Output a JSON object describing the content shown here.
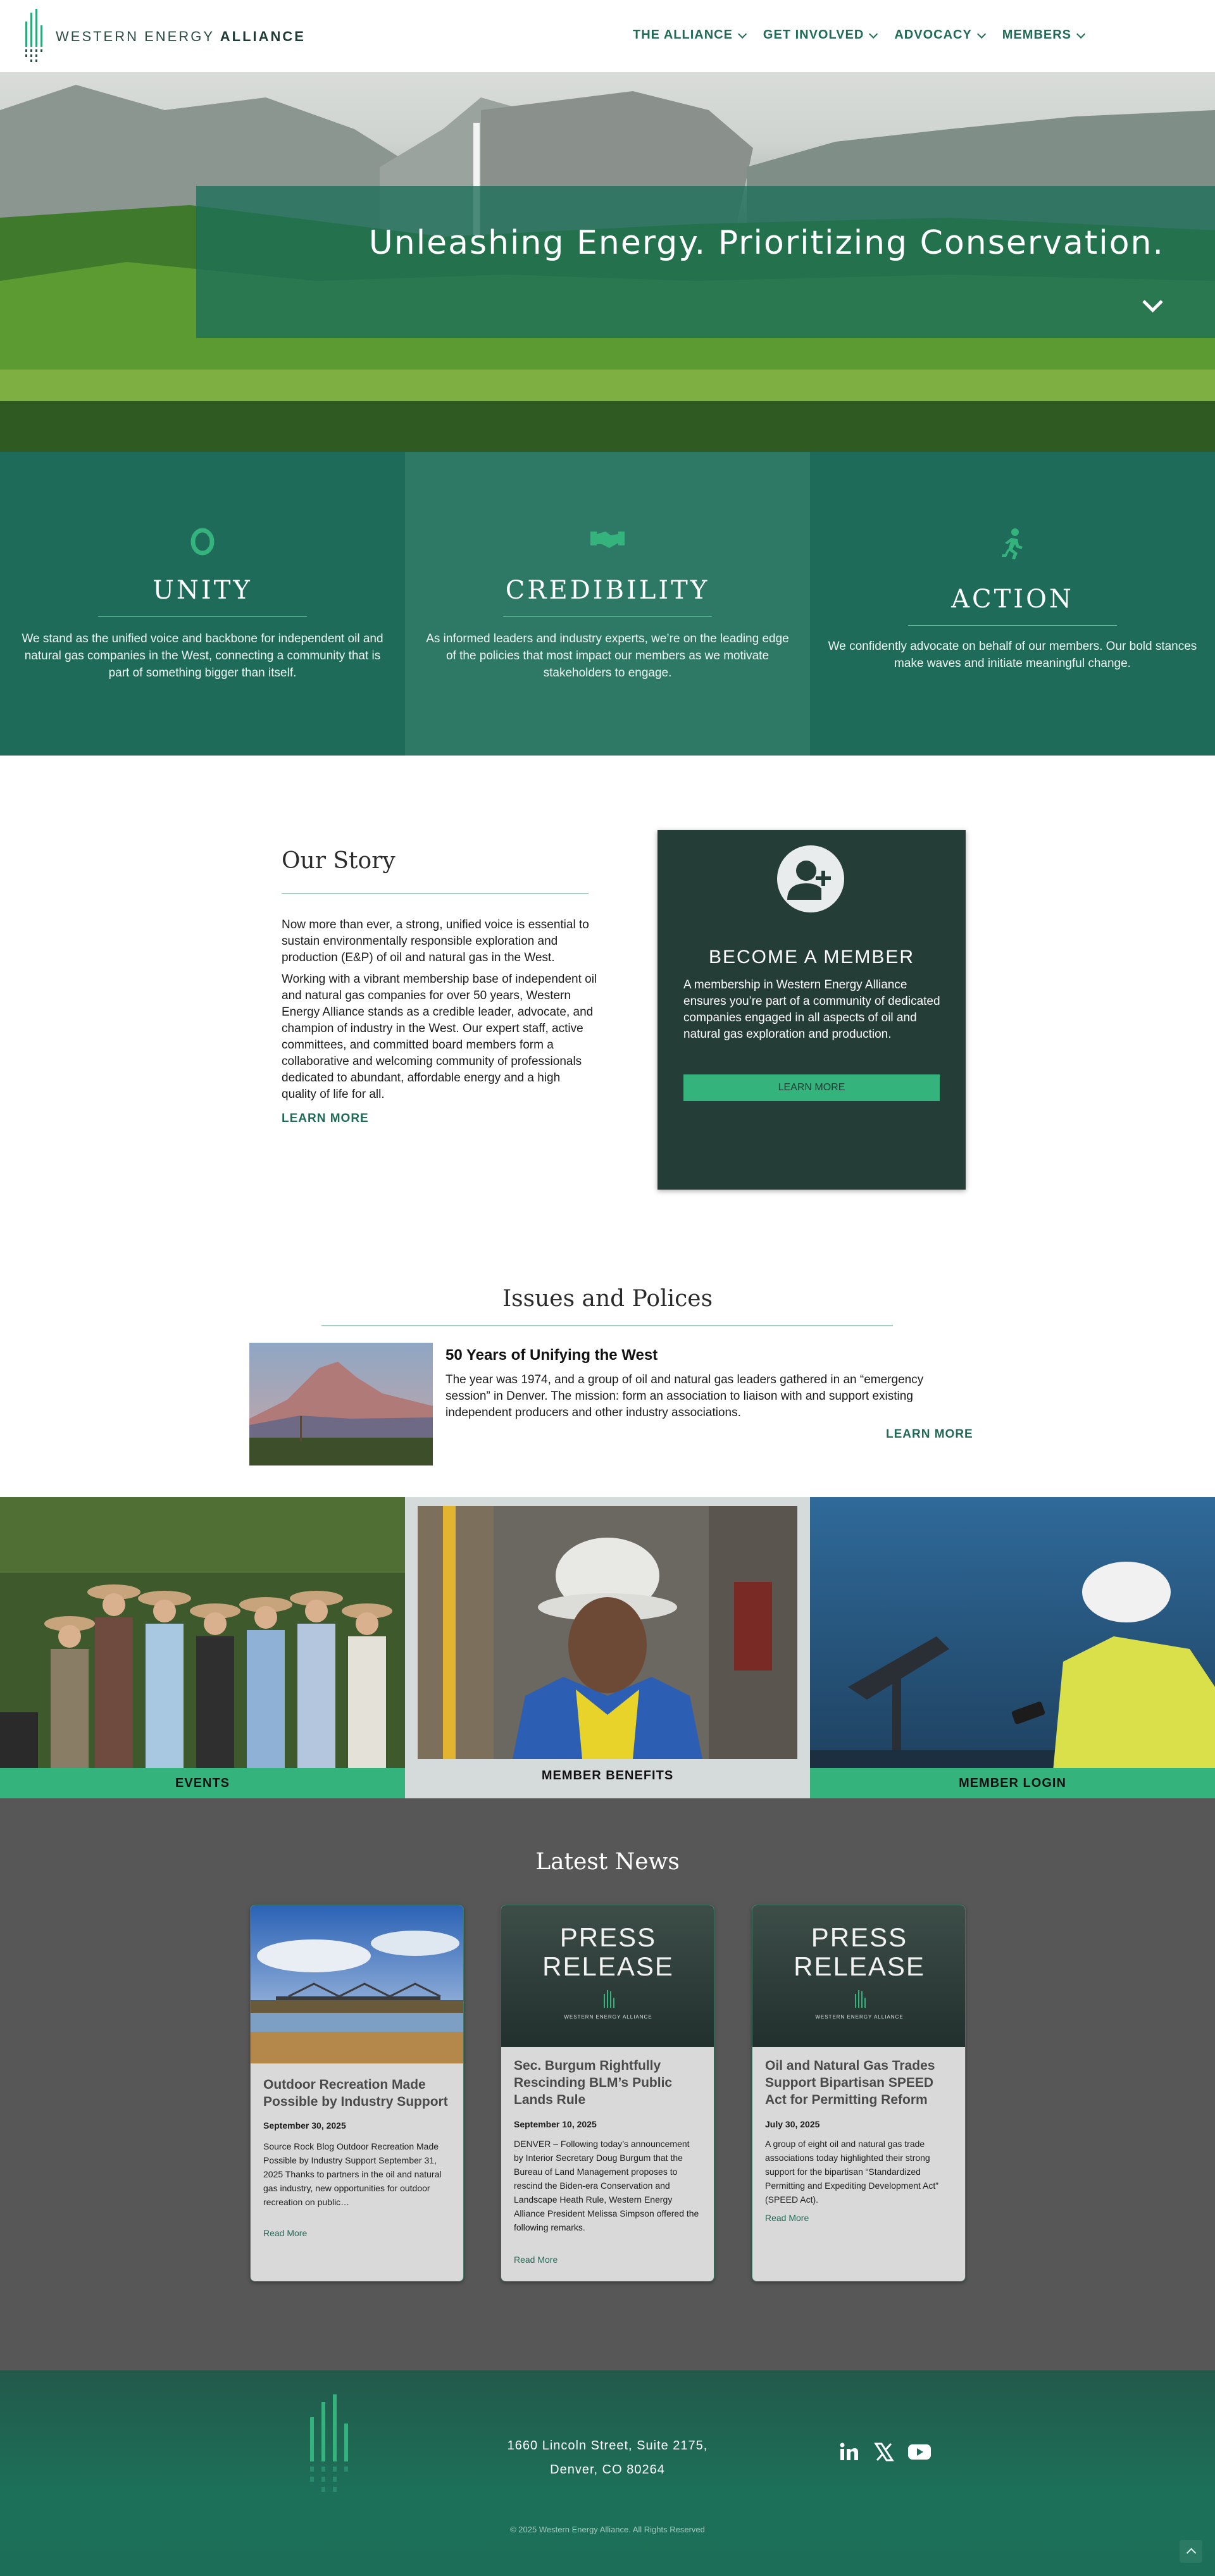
{
  "header": {
    "logo_text_light": "WESTERN ENERGY",
    "logo_text_bold": "ALLIANCE",
    "nav": [
      {
        "label": "THE ALLIANCE"
      },
      {
        "label": "GET INVOLVED"
      },
      {
        "label": "ADVOCACY"
      },
      {
        "label": "MEMBERS"
      }
    ]
  },
  "hero": {
    "title": "Unleashing Energy. Prioritizing Conservation."
  },
  "values": [
    {
      "title": "UNITY",
      "icon": "leaf-ring-icon",
      "text": "We stand as the unified voice and backbone for independent oil and natural gas companies in the West, connecting a community that is part of something bigger than itself."
    },
    {
      "title": "CREDIBILITY",
      "icon": "handshake-icon",
      "text": "As informed leaders and industry experts, we’re on the leading edge of the policies that most impact our members as we motivate stakeholders to engage."
    },
    {
      "title": "ACTION",
      "icon": "running-person-icon",
      "text": "We confidently advocate on behalf of our members. Our bold stances make waves and initiate meaningful change."
    }
  ],
  "story": {
    "title": "Our Story",
    "p1": "Now more than ever, a strong, unified voice is essential to sustain environmentally responsible exploration and production (E&P) of oil and natural gas in the West.",
    "p2": "Working with a vibrant membership base of independent oil and natural gas companies for over 50 years, Western Energy Alliance stands as a credible leader, advocate, and champion of industry in the West. Our expert staff, active committees, and committed board members form a collaborative and welcoming community of professionals dedicated to abundant, affordable energy and a high quality of life for all.",
    "learn_more": "LEARN MORE"
  },
  "member": {
    "title": "BECOME A MEMBER",
    "text": "A membership in Western Energy Alliance ensures you’re part of a community of dedicated companies engaged in all aspects of oil and natural gas exploration and production.",
    "button": "LEARN MORE"
  },
  "issues": {
    "title": "Issues and Polices",
    "item_title": "50 Years of Unifying the West",
    "item_text": "The year was 1974, and a group of oil and natural gas leaders gathered in an “emergency session” in Denver. The mission: form an association to liaison with and support existing independent producers and other industry associations.",
    "learn_more": "LEARN MORE"
  },
  "tiles": [
    {
      "label": "EVENTS"
    },
    {
      "label": "MEMBER BENEFITS"
    },
    {
      "label": "MEMBER LOGIN"
    }
  ],
  "news": {
    "title": "Latest News",
    "press_release_line1": "PRESS",
    "press_release_line2": "RELEASE",
    "press_release_logo": "WESTERN ENERGY ALLIANCE",
    "cards": [
      {
        "title": "Outdoor Recreation Made Possible by Industry Support",
        "date": "September 30, 2025",
        "text": "Source Rock Blog Outdoor Recreation Made Possible by Industry Support September 31, 2025 Thanks to partners in the oil and natural gas industry, new opportunities for outdoor recreation on public…",
        "more": "Read More"
      },
      {
        "title": "Sec. Burgum Rightfully Rescinding BLM’s Public Lands Rule",
        "date": "September 10, 2025",
        "text": "DENVER – Following today’s announcement by Interior Secretary Doug Burgum that the Bureau of Land Management proposes to rescind the Biden-era Conservation and Landscape Heath Rule, Western Energy Alliance President Melissa Simpson offered the following remarks.",
        "more": "Read More"
      },
      {
        "title": "Oil and Natural Gas Trades Support Bipartisan SPEED Act for Permitting Reform",
        "date": "July 30, 2025",
        "text": "A group of eight oil and natural gas trade associations today highlighted their strong support for the bipartisan “Standardized Permitting and Expediting Development Act” (SPEED Act).",
        "more": "Read More"
      }
    ]
  },
  "footer": {
    "address_line1": "1660 Lincoln Street, Suite 2175,",
    "address_line2": "Denver, CO 80264",
    "copyright": "© 2025 Western Energy Alliance.  All Rights Reserved",
    "social": [
      "linkedin-icon",
      "x-icon",
      "youtube-icon"
    ]
  },
  "colors": {
    "brand_green": "#1e6b59",
    "accent_green": "#35b37d",
    "dark_panel": "#243d37",
    "news_bg": "#575757"
  }
}
